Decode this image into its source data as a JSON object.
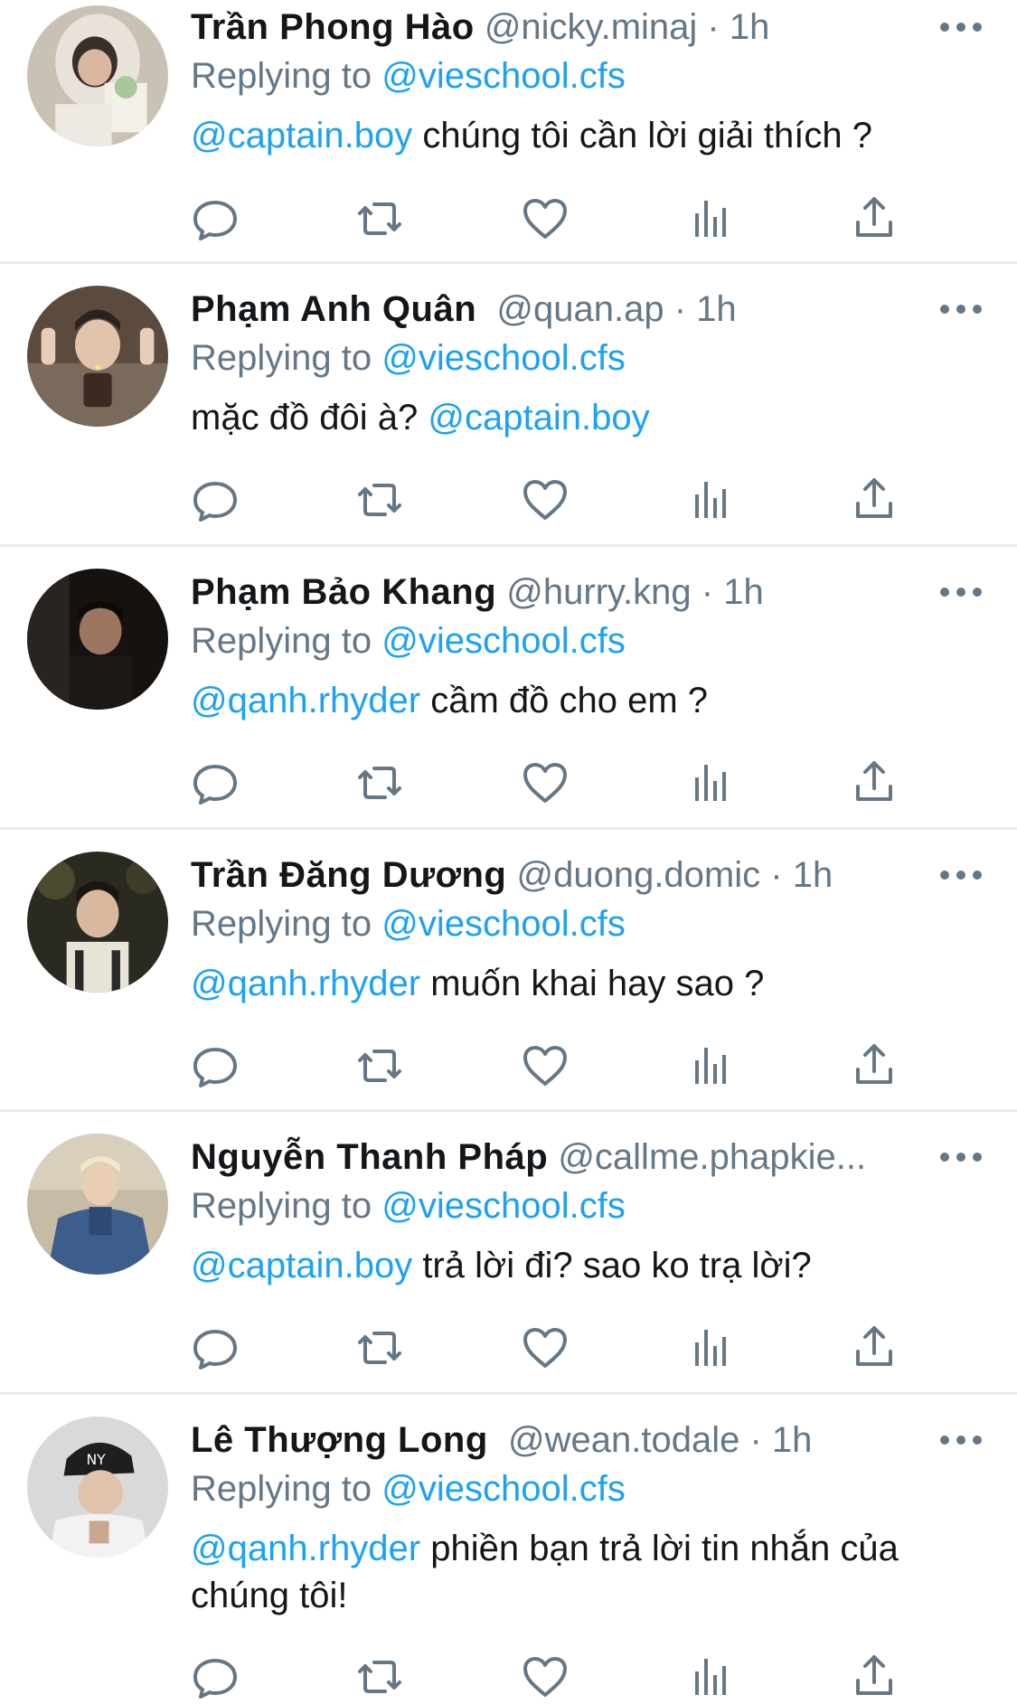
{
  "colors": {
    "link": "#1da1f2",
    "secondary_text": "#657786",
    "divider": "#e6ecf0",
    "icon": "#657786"
  },
  "tweets": [
    {
      "name": "Trần Phong Hào",
      "handle": "@nicky.minaj",
      "dot": "·",
      "time": "1h",
      "replying_prefix": "Replying to",
      "replying_to": "@vieschool.cfs",
      "mention": "@captain.boy",
      "text": " chúng tôi cần lời giải thích ?"
    },
    {
      "name": "Phạm Anh Quân",
      "handle": "@quan.ap",
      "dot": "·",
      "time": "1h",
      "replying_prefix": "Replying to",
      "replying_to": "@vieschool.cfs",
      "text": "mặc đồ đôi à? ",
      "mention_after": "@captain.boy"
    },
    {
      "name": "Phạm Bảo Khang",
      "handle": "@hurry.kng",
      "dot": "·",
      "time": "1h",
      "replying_prefix": "Replying to",
      "replying_to": "@vieschool.cfs",
      "mention": "@qanh.rhyder",
      "text": " cầm đồ cho em ?"
    },
    {
      "name": "Trần Đăng Dương",
      "handle": "@duong.domic",
      "dot": "·",
      "time": "1h",
      "replying_prefix": "Replying to",
      "replying_to": "@vieschool.cfs",
      "mention": "@qanh.rhyder",
      "text": " muốn khai hay sao ?"
    },
    {
      "name": "Nguyễn Thanh Pháp",
      "handle": "@callme.phapkie...",
      "dot": "",
      "time": "",
      "replying_prefix": "Replying to",
      "replying_to": "@vieschool.cfs",
      "mention": "@captain.boy",
      "text": " trả lời đi? sao ko trạ lời?"
    },
    {
      "name": "Lê Thượng Long",
      "handle": "@wean.todale",
      "dot": "·",
      "time": "1h",
      "replying_prefix": "Replying to",
      "replying_to": "@vieschool.cfs",
      "mention": "@qanh.rhyder",
      "text": " phiền bạn trả lời tin nhắn của chúng tôi!"
    }
  ],
  "action_icons": [
    "reply-icon",
    "retweet-icon",
    "like-icon",
    "analytics-icon",
    "share-icon"
  ]
}
